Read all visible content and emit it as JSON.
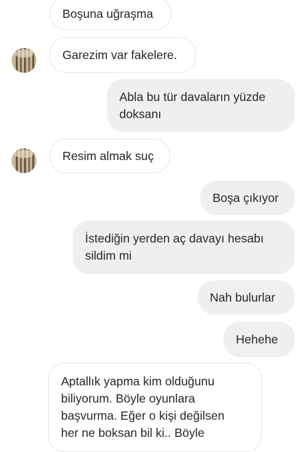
{
  "messages": [
    {
      "id": "m1",
      "direction": "incoming",
      "text": "Boşuna uğraşma"
    },
    {
      "id": "m2",
      "direction": "incoming",
      "text": "Garezim var fakelere."
    },
    {
      "id": "m3",
      "direction": "outgoing",
      "text": "Abla bu tür davaların yüzde\ndoksanı"
    },
    {
      "id": "m4",
      "direction": "incoming",
      "text": "Resim almak suç"
    },
    {
      "id": "m5",
      "direction": "outgoing",
      "text": "Boşa çıkıyor"
    },
    {
      "id": "m6",
      "direction": "outgoing",
      "text": "İstediğin yerden aç davayı hesabı\nsildim mi"
    },
    {
      "id": "m7",
      "direction": "outgoing",
      "text": "Nah bulurlar"
    },
    {
      "id": "m8",
      "direction": "outgoing",
      "text": "Hehehe"
    },
    {
      "id": "m9",
      "direction": "incoming",
      "text": "Aptallık yapma kim olduğunu\nbiliyorum. Böyle oyunlara\nbaşvurma. Eğer o kişi değilsen\nher ne boksan bil ki.. Böyle"
    }
  ],
  "colors": {
    "incoming_bg": "#ffffff",
    "incoming_border": "#e6e6e6",
    "outgoing_bg": "#efefef",
    "text": "#262626"
  },
  "icons": {
    "avatar": "contact-avatar-photo"
  }
}
